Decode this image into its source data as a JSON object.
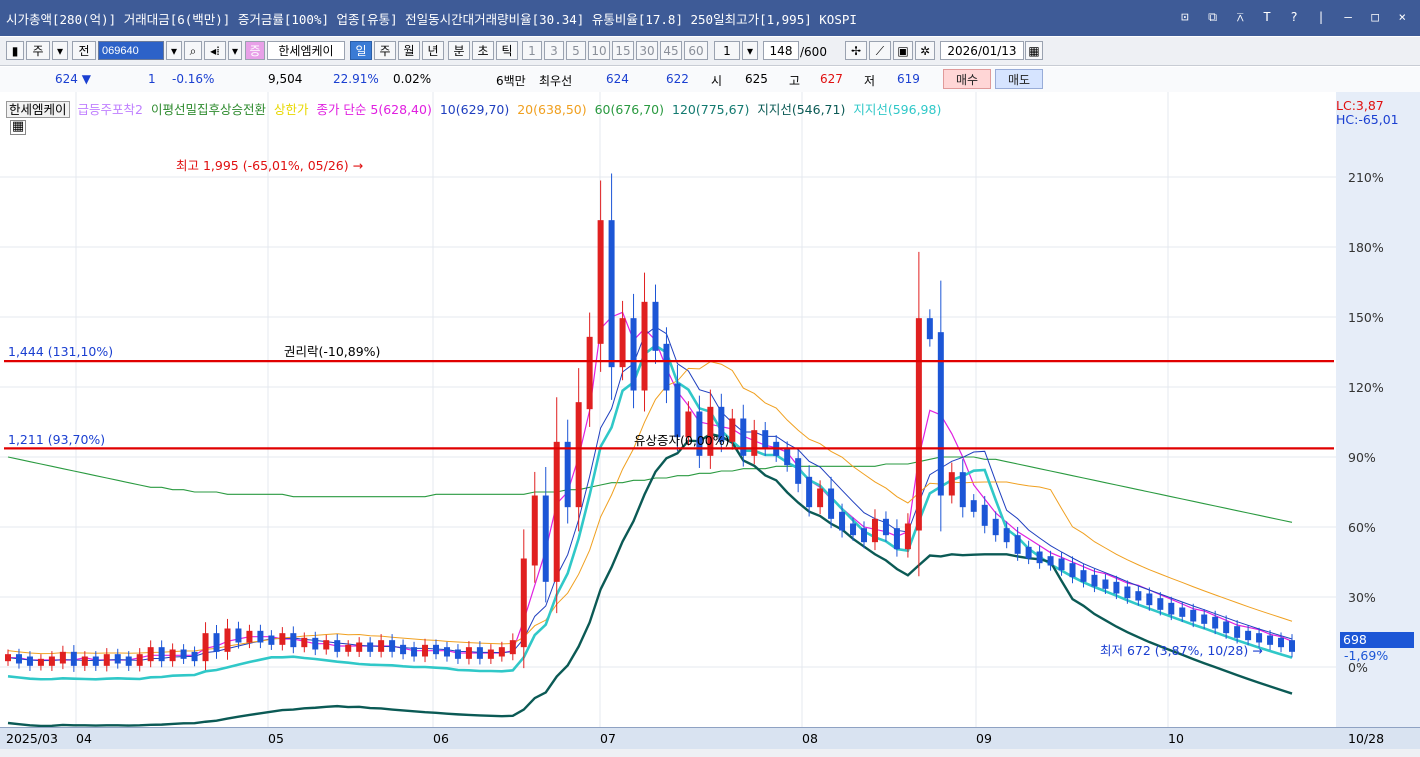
{
  "title_bar": {
    "text": "시가총액[280(억)] 거래대금[6(백만)] 증거금률[100%] 업종[유통] 전일동시간대거래량비율[30.34] 유통비율[17.8] 250일최고가[1,995] KOSPI",
    "controls": "⊡ ⧉ ⊼ T ? | – □ ×"
  },
  "toolbar": {
    "market": "주",
    "prefix": "전",
    "code": "069640",
    "stock_flag": "증",
    "stock_name": "한세엠케이",
    "periods": [
      "일",
      "주",
      "월",
      "년",
      "분",
      "초",
      "틱"
    ],
    "selected_period": "일",
    "minute_steps": [
      "1",
      "3",
      "5",
      "10",
      "15",
      "30",
      "45",
      "60"
    ],
    "unit_value": "1",
    "count": "148",
    "count_max": "/600",
    "date": "2026/01/13"
  },
  "quote": {
    "price": "624 ▼",
    "change": "1",
    "change_pct": "-0.16%",
    "volume": "9,504",
    "volume_ratio": "22.91%",
    "turnover": "0.02%",
    "amount": "6백만",
    "best_label": "최우선",
    "ask": "624",
    "bid": "622",
    "open_label": "시",
    "open": "625",
    "high_label": "고",
    "high": "627",
    "low_label": "저",
    "low": "619",
    "buy_label": "매수",
    "sell_label": "매도"
  },
  "legend": {
    "name": "한세엠케이",
    "items": [
      {
        "text": "급등주포착2",
        "color": "#c080ff"
      },
      {
        "text": "이평선밀집후상승전환",
        "color": "#2e8b2e"
      },
      {
        "text": "상한가",
        "color": "#e8d800"
      },
      {
        "text": "종가 단순 5(628,40)",
        "color": "#e020e0"
      },
      {
        "text": "10(629,70)",
        "color": "#1f3fbf"
      },
      {
        "text": "20(638,50)",
        "color": "#f0a020"
      },
      {
        "text": "60(676,70)",
        "color": "#2a9a40"
      },
      {
        "text": "120(775,67)",
        "color": "#137a70"
      },
      {
        "text": "지지선(546,71)",
        "color": "#0b5a55"
      },
      {
        "text": "지지선(596,98)",
        "color": "#30c8c8"
      }
    ]
  },
  "annotations": {
    "lc": "LC:3,87",
    "hc": "HC:-65,01",
    "high_note": "최고 1,995 (-65,01%, 05/26) →",
    "low_note": "최저 672 (3,87%, 10/28) →",
    "line1": "1,444 (131,10%)",
    "line2": "1,211 (93,70%)",
    "rights_note": "권리락(-10,89%)",
    "capital_note": "유상증자(0,00%)",
    "last_price": "698",
    "last_change": "-1,69%"
  },
  "y_axis_ticks": [
    "210%",
    "180%",
    "150%",
    "120%",
    "90%",
    "60%",
    "30%",
    "0%"
  ],
  "x_axis_labels": [
    "2025/03",
    "04",
    "05",
    "06",
    "07",
    "08",
    "09",
    "10",
    "10/28"
  ],
  "chart_data": {
    "type": "candlestick",
    "x_start": "2025-03-17",
    "x_end": "2025-10-28",
    "y_unit": "% vs last close",
    "ylim": [
      -5,
      225
    ],
    "closes_pct": [
      4,
      3,
      2,
      2,
      3,
      5,
      2,
      3,
      2,
      4,
      3,
      2,
      4,
      7,
      4,
      6,
      5,
      4,
      13,
      8,
      15,
      12,
      14,
      12,
      11,
      13,
      10,
      11,
      9,
      10,
      8,
      8,
      9,
      8,
      10,
      8,
      7,
      6,
      8,
      7,
      6,
      5,
      7,
      5,
      6,
      7,
      10,
      45,
      72,
      38,
      95,
      70,
      112,
      140,
      190,
      130,
      148,
      120,
      155,
      137,
      120,
      100,
      108,
      92,
      110,
      98,
      105,
      92,
      100,
      95,
      92,
      88,
      80,
      70,
      75,
      65,
      60,
      58,
      55,
      62,
      58,
      52,
      60,
      148,
      142,
      75,
      82,
      70,
      68,
      62,
      58,
      55,
      50,
      48,
      46,
      45,
      43,
      40,
      38,
      36,
      35,
      33,
      31,
      30,
      28,
      26,
      24,
      23,
      21,
      20,
      18,
      16,
      14,
      13,
      12,
      11,
      10,
      8
    ],
    "horizontal_lines": [
      {
        "label": "1,444 (131,10%)",
        "pct": 131.1
      },
      {
        "label": "1,211 (93,70%)",
        "pct": 93.7
      }
    ],
    "ma_series": [
      {
        "name": "5",
        "values": [
          4,
          4,
          3,
          3,
          3,
          3,
          3,
          4,
          3,
          3,
          3,
          3,
          4,
          5,
          5,
          5,
          5,
          5,
          8,
          9,
          11,
          12,
          13,
          13,
          13,
          12,
          12,
          11,
          10,
          10,
          9,
          9,
          9,
          9,
          9,
          9,
          8,
          7,
          7,
          7,
          7,
          6,
          6,
          6,
          6,
          6,
          7,
          20,
          35,
          50,
          70,
          75,
          90,
          110,
          145,
          150,
          152,
          140,
          145,
          140,
          128,
          118,
          112,
          105,
          104,
          103,
          102,
          99,
          97,
          95,
          94,
          92,
          86,
          80,
          77,
          72,
          68,
          64,
          60,
          59,
          58,
          56,
          58,
          90,
          110,
          108,
          100,
          90,
          78,
          72,
          66,
          62,
          58,
          55,
          52,
          49,
          47,
          45,
          43,
          41,
          40,
          38,
          36,
          35,
          33,
          31,
          29,
          27,
          25,
          24,
          22,
          20,
          18,
          17,
          16,
          14,
          13,
          11
        ]
      },
      {
        "name": "120",
        "values": [
          90,
          89,
          88,
          87,
          86,
          85,
          84,
          83,
          82,
          81,
          80,
          79,
          78,
          77,
          77,
          76,
          76,
          75,
          75,
          75,
          74,
          74,
          74,
          74,
          74,
          74,
          73,
          73,
          73,
          73,
          73,
          73,
          73,
          73,
          73,
          73,
          73,
          73,
          73,
          74,
          74,
          74,
          74,
          74,
          74,
          74,
          74,
          74,
          75,
          75,
          75,
          76,
          76,
          77,
          78,
          79,
          79,
          80,
          80,
          81,
          81,
          82,
          82,
          83,
          83,
          84,
          84,
          85,
          85,
          85,
          86,
          86,
          86,
          86,
          86,
          86,
          86,
          86,
          86,
          86,
          87,
          87,
          87,
          88,
          89,
          90,
          90,
          90,
          90,
          89,
          89,
          88,
          87,
          86,
          85,
          84,
          83,
          82,
          81,
          80,
          79,
          78,
          77,
          76,
          75,
          74,
          73,
          72,
          71,
          70,
          69,
          68,
          67,
          66,
          65,
          64,
          63,
          62
        ]
      }
    ]
  },
  "colors": {
    "up": "#e02020",
    "down": "#1c56d6",
    "title_bg": "#3e5b97",
    "resistance_line": "#e00000"
  }
}
